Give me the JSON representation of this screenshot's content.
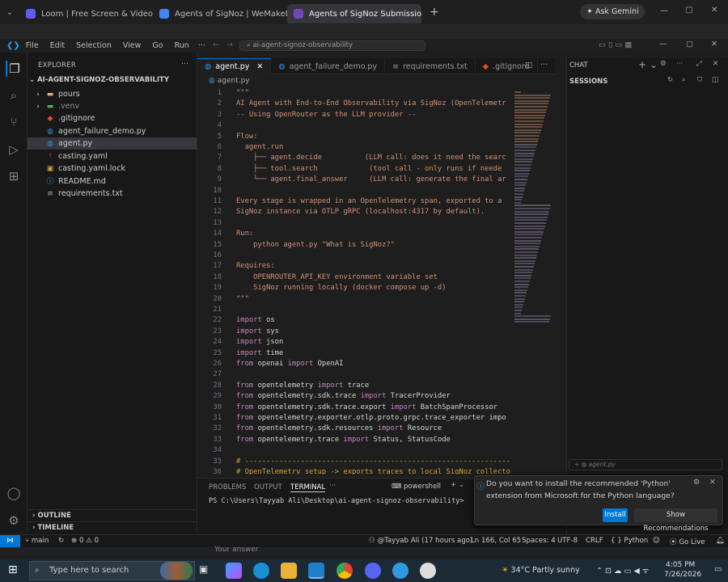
{
  "browser": {
    "tabs": [
      {
        "title": "Loom | Free Screen & Video Re",
        "fav": "#5f5cf1"
      },
      {
        "title": "Agents of SigNoz | WeMakeDe",
        "fav": "#4285f4"
      },
      {
        "title": "Agents of SigNoz Submissions",
        "fav": "#7248b9"
      }
    ],
    "ask": "Ask Gemini"
  },
  "vscode": {
    "menu": [
      "File",
      "Edit",
      "Selection",
      "View",
      "Go",
      "Run"
    ],
    "command_center": "ai-agent-signoz-observability",
    "explorer": {
      "header": "EXPLORER",
      "root": "AI-AGENT-SIGNOZ-OBSERVABILITY",
      "items": [
        {
          "label": "pours",
          "kind": "folder"
        },
        {
          "label": ".venv",
          "kind": "folder-venv"
        },
        {
          "label": ".gitignore",
          "kind": "git"
        },
        {
          "label": "agent_failure_demo.py",
          "kind": "py"
        },
        {
          "label": "agent.py",
          "kind": "py"
        },
        {
          "label": "casting.yaml",
          "kind": "yaml"
        },
        {
          "label": "casting.yaml.lock",
          "kind": "lock"
        },
        {
          "label": "README.md",
          "kind": "md"
        },
        {
          "label": "requirements.txt",
          "kind": "txt"
        }
      ],
      "outline": "OUTLINE",
      "timeline": "TIMELINE"
    },
    "editor_tabs": [
      "agent.py",
      "agent_failure_demo.py",
      "requirements.txt",
      ".gitignore"
    ],
    "breadcrumb": "agent.py",
    "code": [
      {
        "n": "1",
        "t": "\"\"\""
      },
      {
        "n": "2",
        "t": "AI Agent with End-to-End Observability via SigNoz (OpenTelemetr"
      },
      {
        "n": "3",
        "t": "-- Using OpenRouter as the LLM provider --"
      },
      {
        "n": "4",
        "t": ""
      },
      {
        "n": "5",
        "t": "Flow:"
      },
      {
        "n": "6",
        "t": "  agent.run"
      },
      {
        "n": "7",
        "t": "    ├── agent.decide          (LLM call: does it need the searc"
      },
      {
        "n": "8",
        "t": "    ├── tool.search            (tool call - only runs if neede"
      },
      {
        "n": "9",
        "t": "    └── agent.final_answer     (LLM call: generate the final ar"
      },
      {
        "n": "10",
        "t": ""
      },
      {
        "n": "11",
        "t": "Every stage is wrapped in an OpenTelemetry span, exported to a"
      },
      {
        "n": "12",
        "t": "SigNoz instance via OTLP gRPC (localhost:4317 by default)."
      },
      {
        "n": "13",
        "t": ""
      },
      {
        "n": "14",
        "t": "Run:"
      },
      {
        "n": "15",
        "t": "    python agent.py \"What is SigNoz?\""
      },
      {
        "n": "16",
        "t": ""
      },
      {
        "n": "17",
        "t": "Requires:"
      },
      {
        "n": "18",
        "t": "    OPENROUTER_API_KEY environment variable set"
      },
      {
        "n": "19",
        "t": "    SigNoz running locally (docker compose up -d)"
      },
      {
        "n": "20",
        "t": "\"\"\""
      },
      {
        "n": "21",
        "t": ""
      },
      {
        "n": "22",
        "t": "import os"
      },
      {
        "n": "23",
        "t": "import sys"
      },
      {
        "n": "24",
        "t": "import json"
      },
      {
        "n": "25",
        "t": "import time"
      },
      {
        "n": "26",
        "t": "from openai import OpenAI"
      },
      {
        "n": "27",
        "t": ""
      },
      {
        "n": "28",
        "t": "from opentelemetry import trace"
      },
      {
        "n": "29",
        "t": "from opentelemetry.sdk.trace import TracerProvider"
      },
      {
        "n": "30",
        "t": "from opentelemetry.sdk.trace.export import BatchSpanProcessor"
      },
      {
        "n": "31",
        "t": "from opentelemetry.exporter.otlp.proto.grpc.trace_exporter impo"
      },
      {
        "n": "32",
        "t": "from opentelemetry.sdk.resources import Resource"
      },
      {
        "n": "33",
        "t": "from opentelemetry.trace import Status, StatusCode"
      },
      {
        "n": "34",
        "t": ""
      },
      {
        "n": "35",
        "t": "# ----------------------------------------------------------------"
      },
      {
        "n": "36",
        "t": "# OpenTelemetry setup -> exports traces to local SigNoz collecto"
      }
    ],
    "panel": {
      "tabs": [
        "PROBLEMS",
        "OUTPUT",
        "TERMINAL"
      ],
      "shell": "powershell",
      "prompt": "PS C:\\Users\\Tayyab Ali\\Desktop\\ai-agent-signoz-observability>"
    },
    "chat": {
      "title": "CHAT",
      "sessions": "SESSIONS",
      "agent": "agent.py"
    },
    "notification": {
      "message": "Do you want to install the recommended 'Python' extension from Microsoft for the Python language?",
      "install": "Install",
      "recommend": "Show Recommendations"
    },
    "status": {
      "branch": "main",
      "problems": "0",
      "warnings": "0",
      "blame": "@Tayyab Ali (17 hours ago)",
      "cursor": "Ln 166, Col 65",
      "spaces": "Spaces: 4",
      "encoding": "UTF-8",
      "eol": "CRLF",
      "language": "Python",
      "golive": "Go Live"
    }
  },
  "page_below": {
    "placeholder": "Your answer"
  },
  "taskbar": {
    "search": "Type here to search",
    "weather": "34°C  Partly sunny",
    "time": "4:05 PM",
    "date": "7/26/2026"
  },
  "colors": {
    "accent": "#0078d4",
    "docstring": "#ce9178",
    "keyword": "#c586c0",
    "statusbar": "#181818"
  }
}
